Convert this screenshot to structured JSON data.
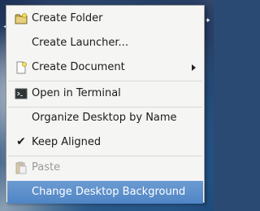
{
  "menu": {
    "items": [
      {
        "label": "Create Folder",
        "icon": "folder-icon"
      },
      {
        "label": "Create Launcher...",
        "icon": ""
      },
      {
        "label": "Create Document",
        "icon": "document-icon",
        "submenu": true
      },
      {
        "label": "Open in Terminal",
        "icon": "terminal-icon"
      },
      {
        "label": "Organize Desktop by Name",
        "icon": ""
      },
      {
        "label": "Keep Aligned",
        "icon": "checkmark-icon",
        "checked": true
      },
      {
        "label": "Paste",
        "icon": "paste-icon",
        "disabled": true
      },
      {
        "label": "Change Desktop Background",
        "icon": "",
        "highlighted": true
      }
    ]
  },
  "colors": {
    "highlight": "#4f85c6",
    "menu_background": "#f5f5f4",
    "disabled_text": "#9a9a9a"
  }
}
